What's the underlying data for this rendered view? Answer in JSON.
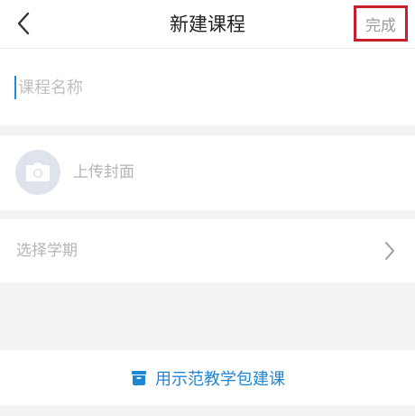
{
  "header": {
    "title": "新建课程",
    "done_label": "完成"
  },
  "form": {
    "course_name_placeholder": "课程名称",
    "course_name_value": "",
    "cover_label": "上传封面",
    "semester_label": "选择学期"
  },
  "template": {
    "label": "用示范教学包建课"
  },
  "icons": {
    "back": "chevron-left-icon",
    "camera": "camera-icon",
    "chevron": "chevron-right-icon",
    "template": "package-icon"
  },
  "colors": {
    "accent": "#1f86d4",
    "highlight_border": "#c8202a",
    "caret": "#1e88e5",
    "placeholder": "#bfbfbf"
  }
}
